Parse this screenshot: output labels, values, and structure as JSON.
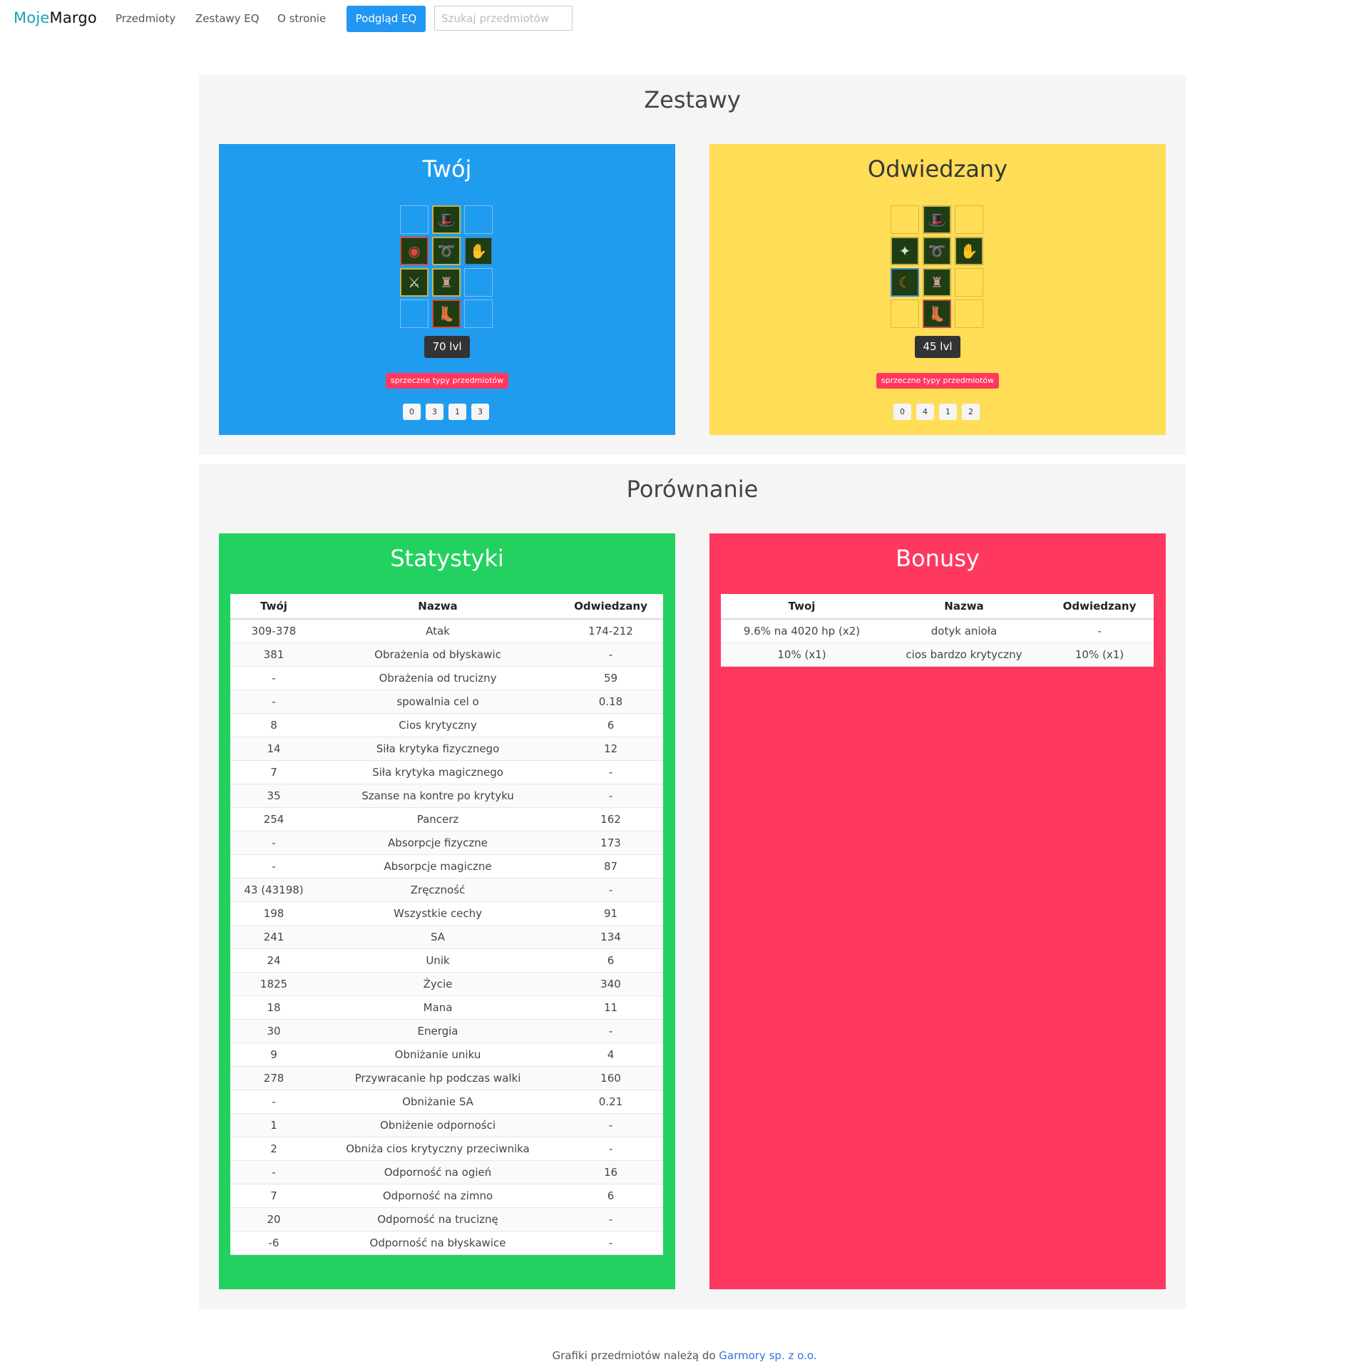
{
  "nav": {
    "brand_part1": "Moje",
    "brand_part2": "Margo",
    "links": [
      "Przedmioty",
      "Zestawy EQ",
      "O stronie"
    ],
    "preview_button": "Podgląd EQ",
    "search_placeholder": "Szukaj przedmiotów"
  },
  "sets": {
    "title": "Zestawy",
    "yours": {
      "title": "Twój",
      "level": "70 lvl",
      "types_label": "sprzeczne typy przedmiotów",
      "counters": [
        "0",
        "3",
        "1",
        "3"
      ],
      "color": "#209cee"
    },
    "visited": {
      "title": "Odwiedzany",
      "level": "45 lvl",
      "types_label": "sprzeczne typy przedmiotów",
      "counters": [
        "0",
        "4",
        "1",
        "2"
      ],
      "color": "#ffdd57"
    }
  },
  "comparison": {
    "title": "Porównanie",
    "stats": {
      "title": "Statystyki",
      "color": "#23d160",
      "headers": [
        "Twój",
        "Nazwa",
        "Odwiedzany"
      ],
      "rows": [
        [
          "309-378",
          "Atak",
          "174-212"
        ],
        [
          "381",
          "Obrażenia od błyskawic",
          "-"
        ],
        [
          "-",
          "Obrażenia od trucizny",
          "59"
        ],
        [
          "-",
          "spowalnia cel o",
          "0.18"
        ],
        [
          "8",
          "Cios krytyczny",
          "6"
        ],
        [
          "14",
          "Siła krytyka fizycznego",
          "12"
        ],
        [
          "7",
          "Siła krytyka magicznego",
          "-"
        ],
        [
          "35",
          "Szanse na kontre po krytyku",
          "-"
        ],
        [
          "254",
          "Pancerz",
          "162"
        ],
        [
          "-",
          "Absorpcje fizyczne",
          "173"
        ],
        [
          "-",
          "Absorpcje magiczne",
          "87"
        ],
        [
          "43 (43198)",
          "Zręczność",
          "-"
        ],
        [
          "198",
          "Wszystkie cechy",
          "91"
        ],
        [
          "241",
          "SA",
          "134"
        ],
        [
          "24",
          "Unik",
          "6"
        ],
        [
          "1825",
          "Życie",
          "340"
        ],
        [
          "18",
          "Mana",
          "11"
        ],
        [
          "30",
          "Energia",
          "-"
        ],
        [
          "9",
          "Obniżanie uniku",
          "4"
        ],
        [
          "278",
          "Przywracanie hp podczas walki",
          "160"
        ],
        [
          "-",
          "Obniżanie SA",
          "0.21"
        ],
        [
          "1",
          "Obniżenie odporności",
          "-"
        ],
        [
          "2",
          "Obniża cios krytyczny przeciwnika",
          "-"
        ],
        [
          "-",
          "Odporność na ogień",
          "16"
        ],
        [
          "7",
          "Odporność na zimno",
          "6"
        ],
        [
          "20",
          "Odporność na truciznę",
          "-"
        ],
        [
          "-6",
          "Odporność na błyskawice",
          "-"
        ]
      ]
    },
    "bonuses": {
      "title": "Bonusy",
      "color": "#ff3860",
      "headers": [
        "Twoj",
        "Nazwa",
        "Odwiedzany"
      ],
      "rows": [
        [
          "9.6% na 4020 hp (x2)",
          "dotyk anioła",
          "-"
        ],
        [
          "10% (x1)",
          "cios bardzo krytyczny",
          "10% (x1)"
        ]
      ]
    }
  },
  "footer": {
    "text": "Grafiki przedmiotów należą do ",
    "link": "Garmory sp. z o.o.",
    "link_color": "#3273dc"
  }
}
